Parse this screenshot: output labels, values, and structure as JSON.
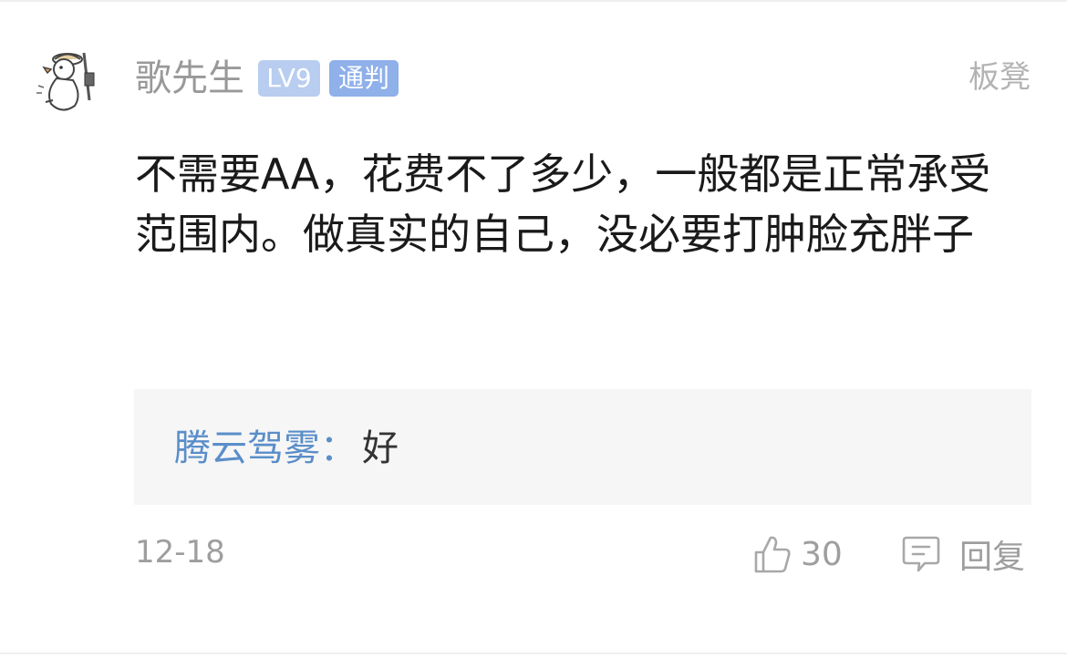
{
  "comment": {
    "user": {
      "name": "歌先生",
      "level_badge": "LV9",
      "title_badge": "通判",
      "avatar_icon": "duck-doodle-avatar"
    },
    "floor_label": "板凳",
    "text": "不需要AA，花费不了多少，一般都是正常承受范围内。做真实的自己，没必要打肿脸充胖子",
    "reply_preview": {
      "author": "腾云驾雾",
      "separator": "：",
      "content": "好"
    },
    "date": "12-18",
    "likes": "30",
    "reply_label": "回复",
    "icons": {
      "like": "thumbs-up-icon",
      "reply": "comment-bubble-icon"
    },
    "colors": {
      "level_badge": "#b8cdef",
      "title_badge": "#8fb0e9",
      "reply_author": "#5a8ec9",
      "muted_text": "#9e9e9e"
    }
  }
}
